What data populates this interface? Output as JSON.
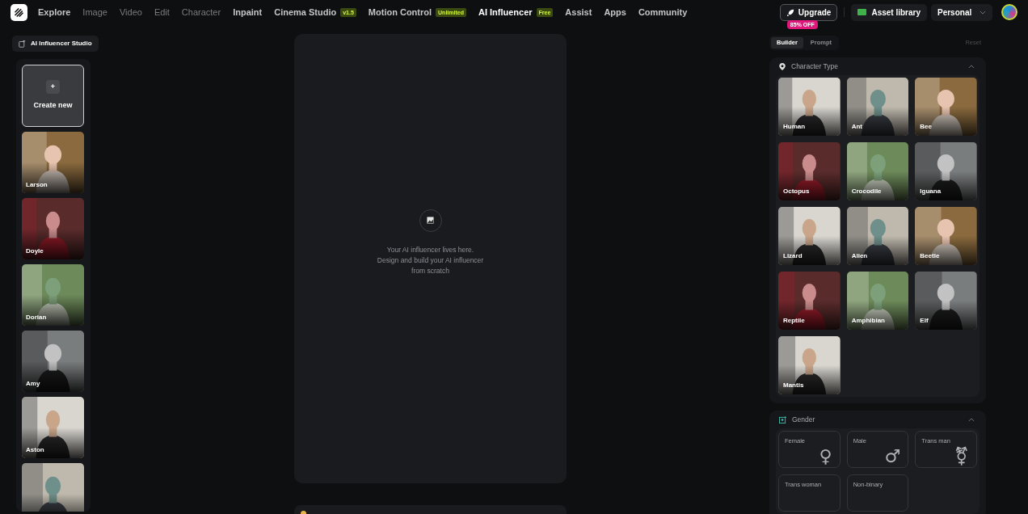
{
  "nav": {
    "items": [
      {
        "label": "Explore",
        "muted": false,
        "selected": false
      },
      {
        "label": "Image",
        "muted": true,
        "selected": false
      },
      {
        "label": "Video",
        "muted": true,
        "selected": false
      },
      {
        "label": "Edit",
        "muted": true,
        "selected": false
      },
      {
        "label": "Character",
        "muted": true,
        "selected": false
      },
      {
        "label": "Inpaint",
        "muted": false,
        "selected": false
      },
      {
        "label": "Cinema Studio",
        "muted": false,
        "selected": false,
        "badge": "v1.5"
      },
      {
        "label": "Motion Control",
        "muted": false,
        "selected": false,
        "badge": "Unlimited"
      },
      {
        "label": "AI Influencer",
        "muted": false,
        "selected": true,
        "badge": "Free"
      },
      {
        "label": "Assist",
        "muted": false,
        "selected": false
      },
      {
        "label": "Apps",
        "muted": false,
        "selected": false
      },
      {
        "label": "Community",
        "muted": false,
        "selected": false
      }
    ],
    "upgrade": {
      "label": "Upgrade",
      "badge": "85% OFF"
    },
    "asset_library": "Asset library",
    "workspace": "Personal"
  },
  "studio_button": "AI Influencer Studio",
  "sidebar": {
    "create": {
      "icon": "+",
      "label": "Create new"
    },
    "characters": [
      {
        "name": "Larson"
      },
      {
        "name": "Doyle"
      },
      {
        "name": "Dorian"
      },
      {
        "name": "Amy"
      },
      {
        "name": "Aston"
      },
      {
        "kind": "picture"
      }
    ]
  },
  "canvas": {
    "message": [
      "Your AI influencer lives here.",
      "Design and build your AI influencer",
      "from scratch"
    ]
  },
  "builder": {
    "tabs": [
      {
        "label": "Builder",
        "selected": true
      },
      {
        "label": "Prompt",
        "selected": false
      }
    ],
    "reset": "Reset",
    "sections": [
      {
        "kind": "grid",
        "title": "Character Type",
        "expanded": true,
        "items": [
          {
            "label": "Human"
          },
          {
            "label": "Ant"
          },
          {
            "label": "Bee"
          },
          {
            "label": "Octopus"
          },
          {
            "label": "Crocodile"
          },
          {
            "label": "Iguana"
          },
          {
            "label": "Lizard"
          },
          {
            "label": "Alien"
          },
          {
            "label": "Beetle"
          },
          {
            "label": "Reptile"
          },
          {
            "label": "Amphibian"
          },
          {
            "label": "Elf"
          },
          {
            "label": "Mantis"
          }
        ]
      },
      {
        "kind": "options",
        "title": "Gender",
        "expanded": true,
        "items": [
          {
            "label": "Female",
            "symbol": "♀"
          },
          {
            "label": "Male",
            "symbol": "♂"
          },
          {
            "label": "Trans man",
            "symbol": "⚧"
          },
          {
            "label": "Trans woman"
          },
          {
            "label": "Non-binary"
          }
        ]
      }
    ]
  }
}
